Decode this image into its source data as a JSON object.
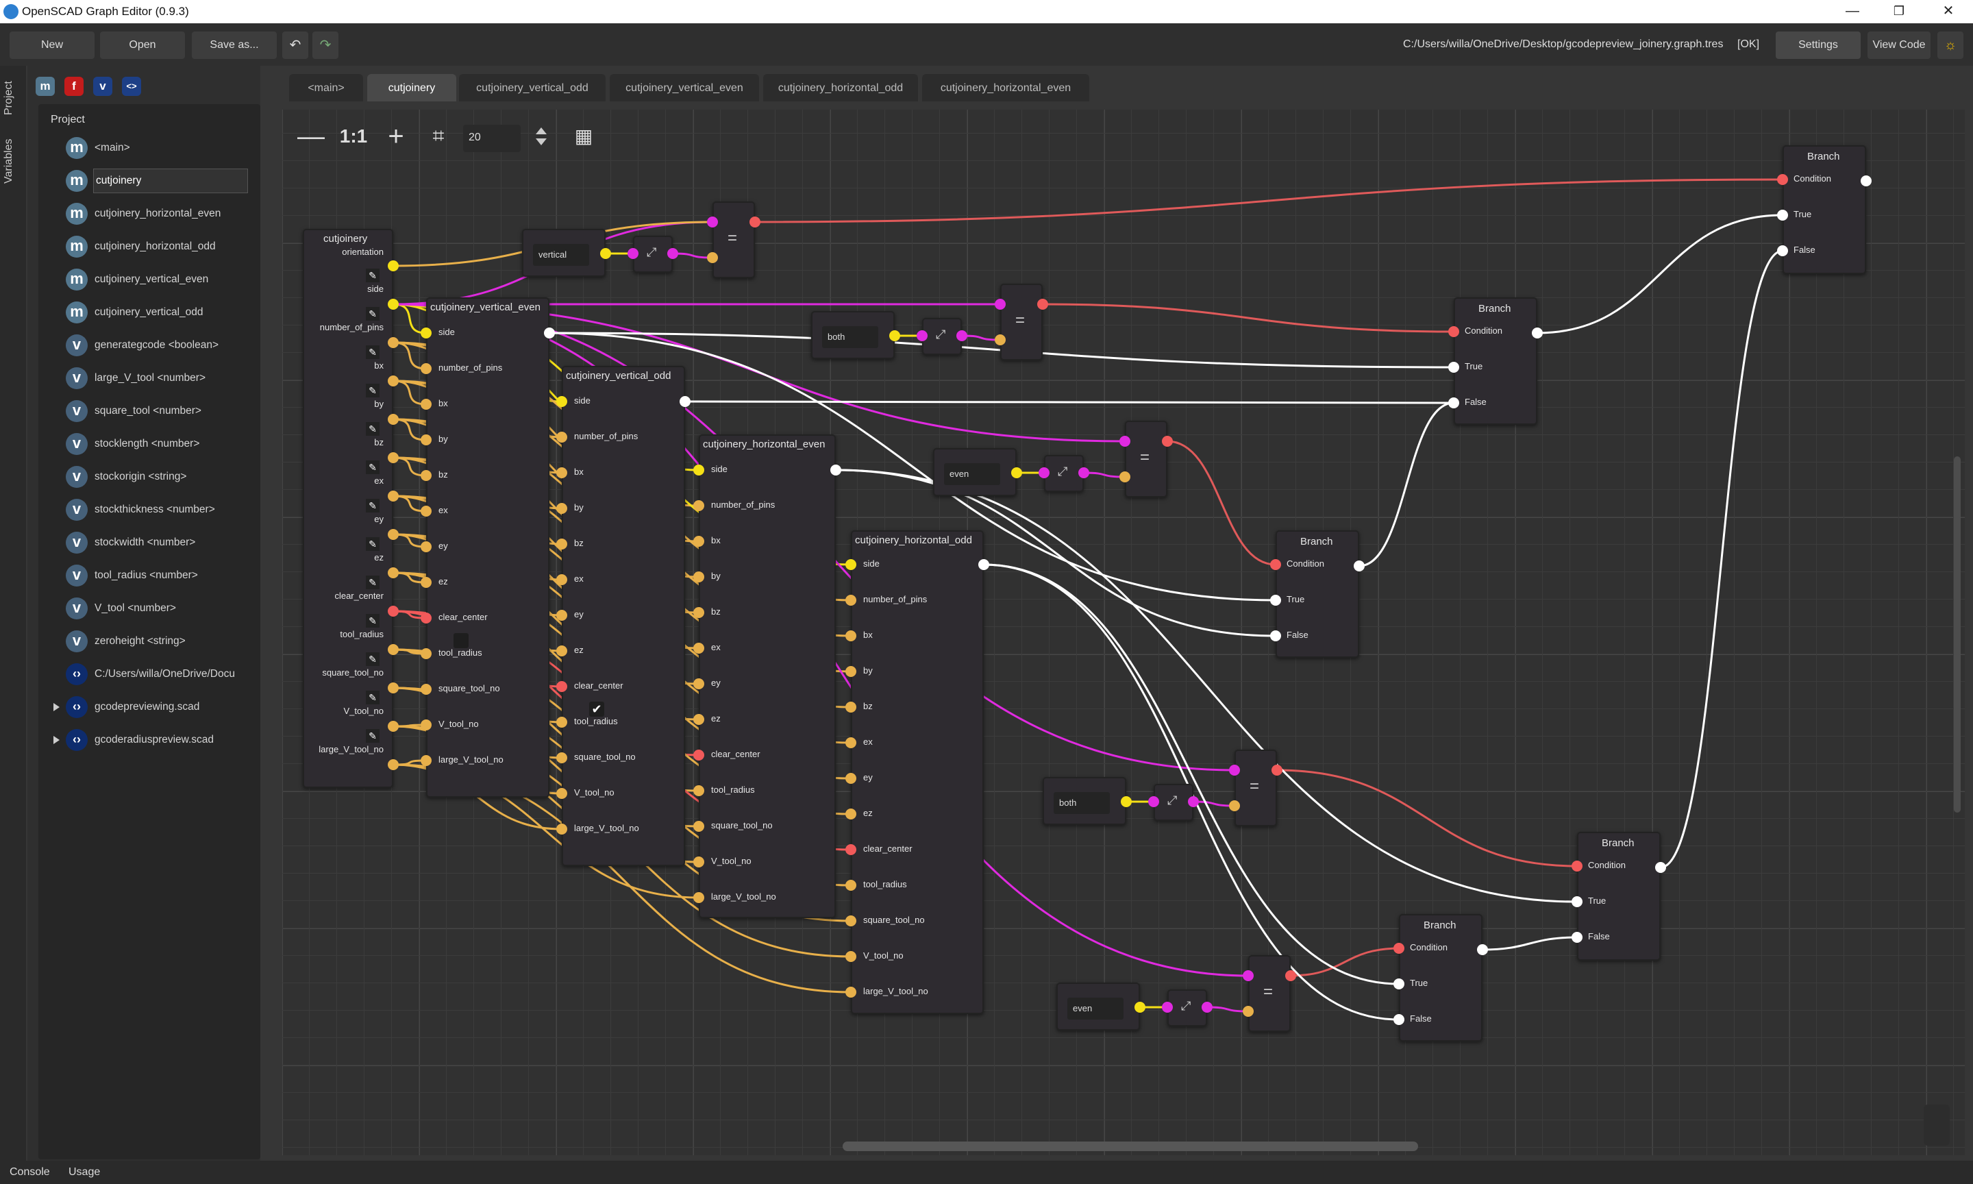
{
  "window": {
    "title": "OpenSCAD Graph Editor (0.9.3)",
    "controls": [
      "—",
      "❐",
      "✕"
    ]
  },
  "toolbar": {
    "new_label": "New",
    "open_label": "Open",
    "saveas_label": "Save as...",
    "undo_icon": "↶",
    "redo_icon": "↷",
    "file_path": "C:/Users/willa/OneDrive/Desktop/gcodepreview_joinery.graph.tres",
    "status": "[OK]",
    "settings_label": "Settings",
    "viewcode_label": "View Code"
  },
  "left_tabs": {
    "project": "Project",
    "variables": "Variables"
  },
  "sidebar": {
    "add_icons": [
      "m",
      "f",
      "v",
      "<>"
    ],
    "tree_header": "Project",
    "items": [
      {
        "kind": "m",
        "label": "<main>"
      },
      {
        "kind": "m",
        "label": "cutjoinery"
      },
      {
        "kind": "m",
        "label": "cutjoinery_horizontal_even"
      },
      {
        "kind": "m",
        "label": "cutjoinery_horizontal_odd"
      },
      {
        "kind": "m",
        "label": "cutjoinery_vertical_even"
      },
      {
        "kind": "m",
        "label": "cutjoinery_vertical_odd"
      },
      {
        "kind": "v",
        "label": "generategcode <boolean>"
      },
      {
        "kind": "v",
        "label": "large_V_tool <number>"
      },
      {
        "kind": "v",
        "label": "square_tool <number>"
      },
      {
        "kind": "v",
        "label": "stocklength <number>"
      },
      {
        "kind": "v",
        "label": "stockorigin <string>"
      },
      {
        "kind": "v",
        "label": "stockthickness <number>"
      },
      {
        "kind": "v",
        "label": "stockwidth <number>"
      },
      {
        "kind": "v",
        "label": "tool_radius <number>"
      },
      {
        "kind": "v",
        "label": "V_tool <number>"
      },
      {
        "kind": "v",
        "label": "zeroheight <string>"
      },
      {
        "kind": "s",
        "label": "C:/Users/willa/OneDrive/Docu"
      },
      {
        "kind": "s",
        "label": "gcodepreviewing.scad"
      },
      {
        "kind": "s",
        "label": "gcoderadiuspreview.scad"
      }
    ]
  },
  "tabs": [
    "<main>",
    "cutjoinery",
    "cutjoinery_vertical_odd",
    "cutjoinery_vertical_even",
    "cutjoinery_horizontal_odd",
    "cutjoinery_horizontal_even"
  ],
  "graph_controls": {
    "zoom_out": "—",
    "reset": "1:1",
    "zoom_in": "+",
    "snap_value": "20"
  },
  "nodes": {
    "entry": {
      "title": "cutjoinery",
      "outputs": [
        "orientation",
        "side",
        "number_of_pins",
        "bx",
        "by",
        "bz",
        "ex",
        "ey",
        "ez",
        "clear_center",
        "tool_radius",
        "square_tool_no",
        "V_tool_no",
        "large_V_tool_no"
      ]
    },
    "vertical_even": {
      "title": "cutjoinery_vertical_even",
      "inputs": [
        "side",
        "number_of_pins",
        "bx",
        "by",
        "bz",
        "ex",
        "ey",
        "ez",
        "clear_center",
        "tool_radius",
        "square_tool_no",
        "V_tool_no",
        "large_V_tool_no"
      ],
      "clear_center_checked": false
    },
    "vertical_odd": {
      "title": "cutjoinery_vertical_odd",
      "inputs": [
        "side",
        "number_of_pins",
        "bx",
        "by",
        "bz",
        "ex",
        "ey",
        "ez",
        "clear_center",
        "tool_radius",
        "square_tool_no",
        "V_tool_no",
        "large_V_tool_no"
      ],
      "clear_center_checked": true
    },
    "horizontal_even": {
      "title": "cutjoinery_horizontal_even",
      "inputs": [
        "side",
        "number_of_pins",
        "bx",
        "by",
        "bz",
        "ex",
        "ey",
        "ez",
        "clear_center",
        "tool_radius",
        "square_tool_no",
        "V_tool_no",
        "large_V_tool_no"
      ]
    },
    "horizontal_odd": {
      "title": "cutjoinery_horizontal_odd",
      "inputs": [
        "side",
        "number_of_pins",
        "bx",
        "by",
        "bz",
        "ex",
        "ey",
        "ez",
        "clear_center",
        "tool_radius",
        "square_tool_no",
        "V_tool_no",
        "large_V_tool_no"
      ]
    },
    "strings": [
      "vertical",
      "both",
      "even",
      "both",
      "even"
    ],
    "equals_symbol": "=",
    "branch": {
      "title": "Branch",
      "ports": [
        "Condition",
        "True",
        "False"
      ]
    }
  },
  "statusbar": {
    "console": "Console",
    "usage": "Usage"
  },
  "colors": {
    "number": "#e8b04a",
    "string": "#f5e016",
    "boolean": "#f25a5a",
    "any": "#e02ae0",
    "flow": "#ffffff"
  }
}
